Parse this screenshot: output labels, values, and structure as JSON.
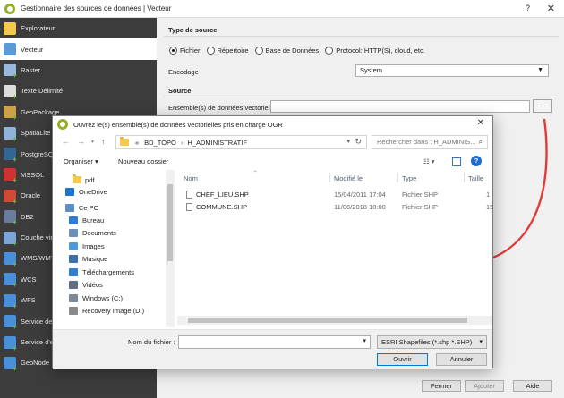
{
  "main_window": {
    "title": "Gestionnaire des sources de données | Vecteur",
    "help_label": "?",
    "close_label": "✕"
  },
  "sidebar": {
    "items": [
      {
        "label": "Explorateur",
        "icon": "folder-icon",
        "color": "#f3c94e"
      },
      {
        "label": "Vecteur",
        "icon": "vector-icon",
        "color": "#5b9bd5",
        "active": true
      },
      {
        "label": "Raster",
        "icon": "raster-icon",
        "color": "#9ab8de"
      },
      {
        "label": "Texte Délimité",
        "icon": "text-delimited-icon",
        "color": "#dddddd"
      },
      {
        "label": "GeoPackage",
        "icon": "geopackage-icon",
        "color": "#c9a24a"
      },
      {
        "label": "SpatiaLite",
        "icon": "spatialite-icon",
        "color": "#8fb3d9"
      },
      {
        "label": "PostgreSQL",
        "icon": "postgresql-icon",
        "color": "#336791"
      },
      {
        "label": "MSSQL",
        "icon": "mssql-icon",
        "color": "#cc3333"
      },
      {
        "label": "Oracle",
        "icon": "oracle-icon",
        "color": "#d04a3a"
      },
      {
        "label": "DB2",
        "icon": "db2-icon",
        "color": "#6b7b9b"
      },
      {
        "label": "Couche virtu",
        "icon": "virtual-layer-icon",
        "color": "#7da6d8"
      },
      {
        "label": "WMS/WMTS",
        "icon": "wms-icon",
        "color": "#4a90d9"
      },
      {
        "label": "WCS",
        "icon": "wcs-icon",
        "color": "#4a90d9"
      },
      {
        "label": "WFS",
        "icon": "wfs-icon",
        "color": "#4a90d9"
      },
      {
        "label": "Service de c",
        "icon": "arcgis-map-icon",
        "color": "#4a90d9"
      },
      {
        "label": "Service d'en",
        "icon": "arcgis-feature-icon",
        "color": "#4a90d9"
      },
      {
        "label": "GeoNode",
        "icon": "geonode-icon",
        "color": "#4a90d9"
      }
    ]
  },
  "source_type": {
    "title": "Type de source",
    "options": [
      "Fichier",
      "Répertoire",
      "Base de Données",
      "Protocol: HTTP(S), cloud, etc."
    ],
    "selected": "Fichier",
    "encoding_label": "Encodage",
    "encoding_value": "System"
  },
  "source": {
    "title": "Source",
    "dataset_label": "Ensemble(s) de données vectorielles",
    "dataset_value": "",
    "browse_label": "..."
  },
  "bottom_buttons": {
    "close": "Fermer",
    "add": "Ajouter",
    "help": "Aide"
  },
  "dialog": {
    "title": "Ouvrez le(s) ensemble(s) de données vectorielles pris en charge OGR",
    "close_label": "✕",
    "breadcrumb": [
      "«",
      "BD_TOPO",
      "H_ADMINISTRATIF"
    ],
    "search_placeholder": "Rechercher dans : H_ADMINIS...",
    "organize_label": "Organiser ▾",
    "new_folder_label": "Nouveau dossier",
    "help_label": "?",
    "nav_items": [
      {
        "label": "pdf",
        "icon": "folder-icon",
        "color": "#f3c94e",
        "indent": 1
      },
      {
        "label": "OneDrive",
        "icon": "onedrive-icon",
        "color": "#1e74c8",
        "indent": 0
      },
      {
        "label": "Ce PC",
        "icon": "pc-icon",
        "color": "#5b8fc7",
        "indent": 0
      },
      {
        "label": "Bureau",
        "icon": "desktop-icon",
        "color": "#2e7bd6",
        "indent": 1
      },
      {
        "label": "Documents",
        "icon": "documents-icon",
        "color": "#6a8fb8",
        "indent": 1
      },
      {
        "label": "Images",
        "icon": "images-icon",
        "color": "#4e9ad6",
        "indent": 1
      },
      {
        "label": "Musique",
        "icon": "music-icon",
        "color": "#3a6fb0",
        "indent": 1
      },
      {
        "label": "Téléchargements",
        "icon": "downloads-icon",
        "color": "#2d7fd0",
        "indent": 1
      },
      {
        "label": "Vidéos",
        "icon": "videos-icon",
        "color": "#5e6e86",
        "indent": 1
      },
      {
        "label": "Windows (C:)",
        "icon": "drive-icon",
        "color": "#7a8a9a",
        "indent": 1
      },
      {
        "label": "Recovery Image (D:)",
        "icon": "drive-icon",
        "color": "#8a8a8a",
        "indent": 1
      }
    ],
    "columns": [
      "Nom",
      "Modifié le",
      "Type",
      "Taille"
    ],
    "files": [
      {
        "name": "CHEF_LIEU.SHP",
        "modified": "15/04/2011 17:04",
        "type": "Fichier SHP",
        "size": "1"
      },
      {
        "name": "COMMUNE.SHP",
        "modified": "11/06/2018 10:00",
        "type": "Fichier SHP",
        "size": "15"
      }
    ],
    "filename_label": "Nom du fichier :",
    "filename_value": "",
    "filter_value": "ESRI Shapefiles (*.shp *.SHP)",
    "open_label": "Ouvrir",
    "cancel_label": "Annuler"
  },
  "colors": {
    "annotation_arrow": "#e23a36",
    "sidebar_bg": "#3c3c3c",
    "primary_border": "#0078d7"
  }
}
